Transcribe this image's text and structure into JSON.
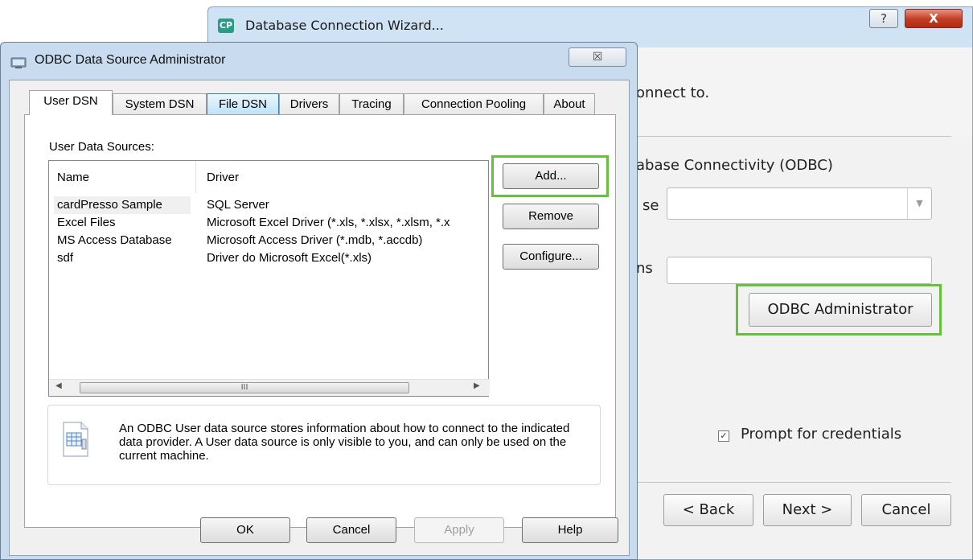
{
  "wizard": {
    "title": "Database Connection Wizard...",
    "icon": "CP",
    "help_label": "?",
    "close_label": "X",
    "instruction_partial": "onnect to.",
    "option_partial": "abase Connectivity (ODBC)",
    "database_label_partial": "se",
    "options_label_partial": "ns",
    "odbc_admin_button": "ODBC Administrator",
    "prompt_checkbox_label": "Prompt for credentials",
    "prompt_checked": true,
    "back_button": "< Back",
    "next_button": "Next >",
    "cancel_button": "Cancel",
    "highlight_color": "#65c03b"
  },
  "odbc": {
    "title": "ODBC Data Source Administrator",
    "close_label": "☒",
    "tabs": [
      "User DSN",
      "System DSN",
      "File DSN",
      "Drivers",
      "Tracing",
      "Connection Pooling",
      "About"
    ],
    "active_tab": "User DSN",
    "sources_label": "User Data Sources:",
    "columns": [
      "Name",
      "Driver"
    ],
    "rows": [
      {
        "name": "cardPresso Sample",
        "driver": "SQL Server"
      },
      {
        "name": "Excel Files",
        "driver": "Microsoft Excel Driver (*.xls, *.xlsx, *.xlsm, *.x"
      },
      {
        "name": "MS Access Database",
        "driver": "Microsoft Access Driver (*.mdb, *.accdb)"
      },
      {
        "name": "sdf",
        "driver": "Driver do Microsoft Excel(*.xls)"
      }
    ],
    "scroll_grip": "III",
    "add_button": "Add...",
    "remove_button": "Remove",
    "configure_button": "Configure...",
    "info_text": "An ODBC User data source stores information about how to connect to the indicated data provider.   A User data source is only visible to you, and can only be used on the current machine.",
    "ok_button": "OK",
    "cancel_button": "Cancel",
    "apply_button": "Apply",
    "help_button": "Help"
  }
}
